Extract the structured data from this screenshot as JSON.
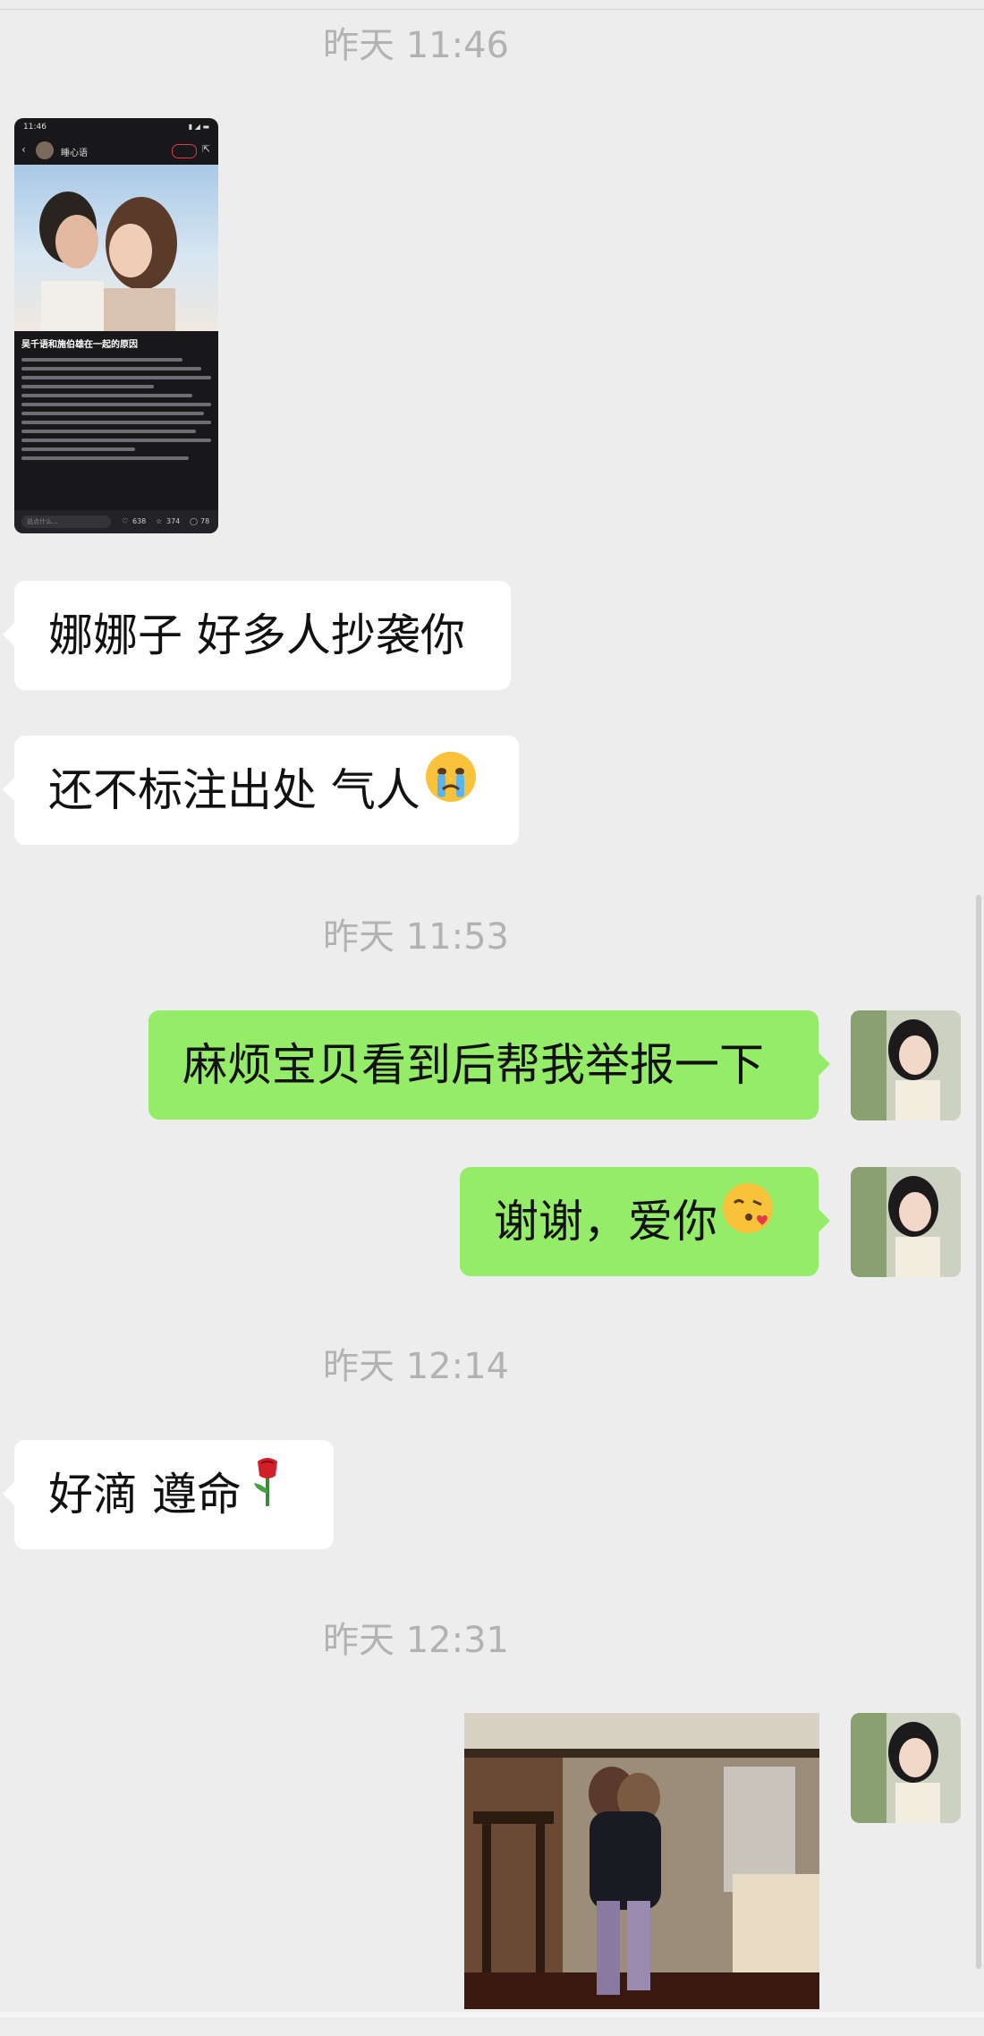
{
  "messages": {
    "ts1": "昨天 11:46",
    "m1": "娜娜子 好多人抄袭你",
    "m2": "还不标注出处 气人",
    "ts2": "昨天 11:53",
    "m3": "麻烦宝贝看到后帮我举报一下",
    "m4": "谢谢，爱你",
    "ts3": "昨天 12:14",
    "m5": "好滴 遵命",
    "ts4": "昨天 12:31"
  },
  "screenshot": {
    "time": "11:46",
    "account": "睡心语",
    "post_title": "吴千语和施伯雄在一起的原因",
    "likes": "638",
    "stars": "374",
    "comments": "78",
    "comment_placeholder": "说点什么..."
  },
  "icons": {
    "m2_emoji": "crying-face-icon",
    "m4_emoji": "kissing-heart-face-icon",
    "m5_emoji": "rose-icon"
  },
  "colors": {
    "background": "#ededed",
    "incoming_bubble": "#ffffff",
    "outgoing_bubble": "#95ec69",
    "timestamp": "#b2b2b2"
  }
}
